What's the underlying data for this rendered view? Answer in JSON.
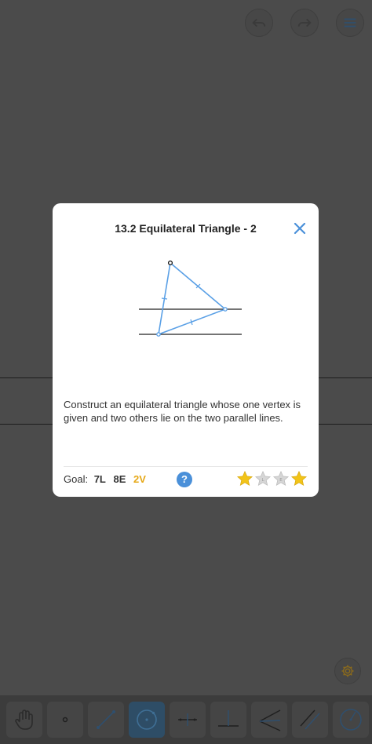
{
  "dialog": {
    "title": "13.2 Equilateral Triangle - 2",
    "description": "Construct an equilateral triangle whose one vertex is given and two others lie on the two parallel lines.",
    "goal": {
      "label": "Goal:",
      "lines": "7L",
      "elementary": "8E",
      "verum": "2V"
    },
    "help_label": "?",
    "rating": {
      "earned": 2,
      "total": 4,
      "states": [
        "filled",
        "empty",
        "empty",
        "filled"
      ]
    }
  },
  "icons": {
    "top": [
      "undo-icon",
      "redo-icon",
      "menu-icon"
    ],
    "settings": "gear-icon",
    "tools": [
      "hand-icon",
      "point-icon",
      "line-icon",
      "circle-icon",
      "perpendicular-bisector-icon",
      "perpendicular-icon",
      "angle-bisector-icon",
      "parallel-icon",
      "compass-icon"
    ],
    "active_tool": "circle-icon"
  },
  "colors": {
    "accent": "#4a90d9",
    "star": "#f2c418",
    "verum": "#e6a817",
    "active_tool": "#2e4d66"
  }
}
